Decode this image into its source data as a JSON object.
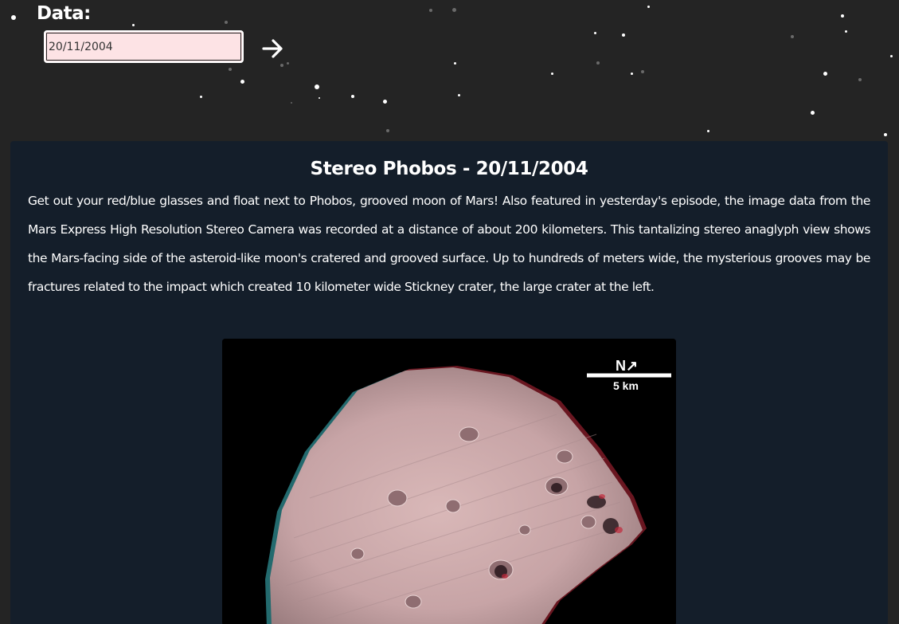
{
  "date_picker": {
    "label": "Data:",
    "value": "20/11/2004"
  },
  "apod": {
    "title": "Stereo Phobos - 20/11/2004",
    "explanation": "Get out your red/blue glasses and float next to Phobos, grooved moon of Mars! Also featured in yesterday's episode, the image data from the Mars Express High Resolution Stereo Camera was recorded at a distance of about 200 kilometers. This tantalizing stereo anaglyph view shows the Mars-facing side of the asteroid-like moon's cratered and grooved surface. Up to hundreds of meters wide, the mysterious grooves may be fractures related to the impact which created 10 kilometer wide Stickney crater, the large crater at the left.",
    "image": {
      "north_label": "N↗",
      "scale_label": "5 km"
    }
  },
  "icons": {
    "submit": "arrow-right-icon"
  },
  "colors": {
    "background": "#242424",
    "card": "#141e2a",
    "input_fill": "#fde3e5",
    "text": "#ffffff"
  }
}
